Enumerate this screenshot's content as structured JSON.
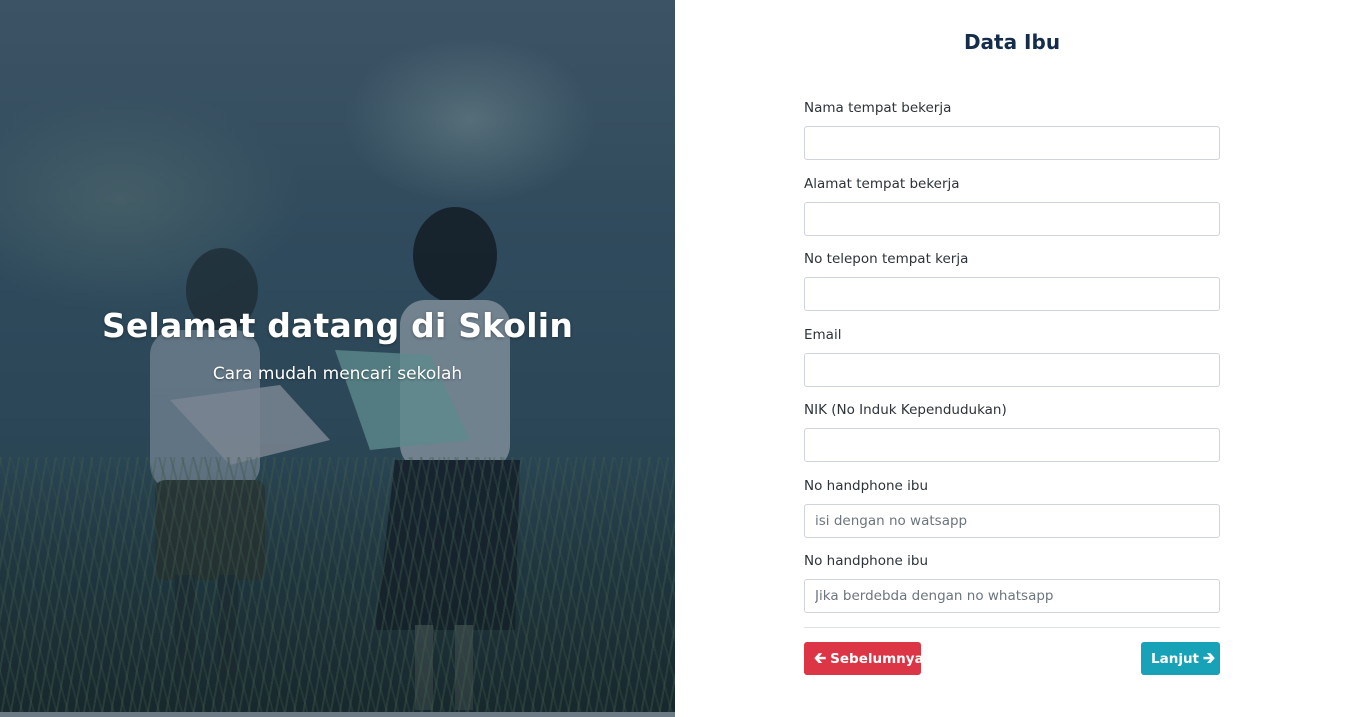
{
  "hero": {
    "title": "Selamat datang di Skolin",
    "subtitle": "Cara mudah mencari sekolah"
  },
  "form": {
    "title": "Data Ibu",
    "fields": [
      {
        "label": "Nama tempat bekerja",
        "value": "",
        "placeholder": ""
      },
      {
        "label": "Alamat tempat bekerja",
        "value": "",
        "placeholder": ""
      },
      {
        "label": "No telepon tempat kerja",
        "value": "",
        "placeholder": ""
      },
      {
        "label": "Email",
        "value": "",
        "placeholder": ""
      },
      {
        "label": "NIK (No Induk Kependudukan)",
        "value": "",
        "placeholder": ""
      },
      {
        "label": "No handphone ibu",
        "value": "",
        "placeholder": "isi dengan no watsapp"
      },
      {
        "label": "No handphone ibu",
        "value": "",
        "placeholder": "Jika berdebda dengan no whatsapp"
      }
    ],
    "buttons": {
      "prev": {
        "label": "Sebelumnya",
        "icon": "arrow-left-icon",
        "color": "#dc3545"
      },
      "next": {
        "label": "Lanjut",
        "icon": "arrow-right-icon",
        "color": "#17a2b8"
      }
    }
  }
}
